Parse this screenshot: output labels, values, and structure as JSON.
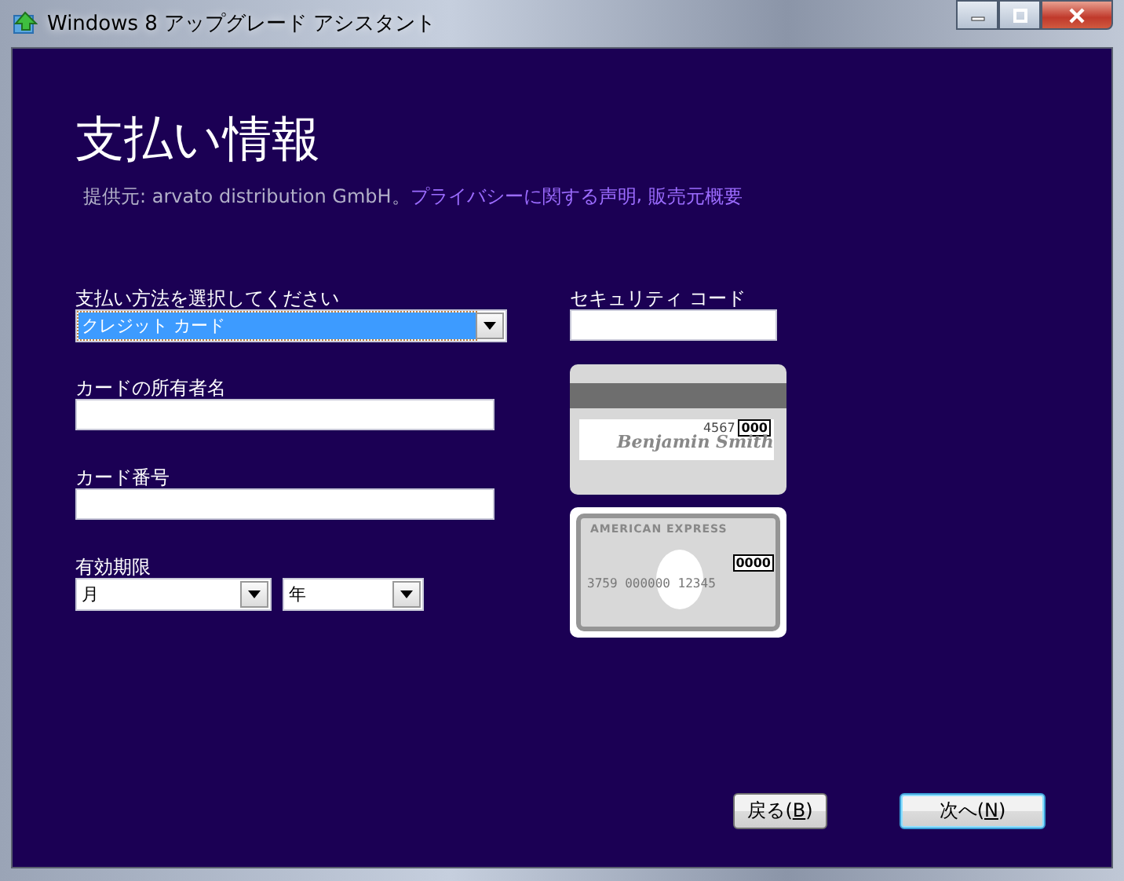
{
  "window": {
    "title": "Windows 8 アップグレード アシスタント"
  },
  "page": {
    "heading": "支払い情報",
    "provider": "提供元: arvato distribution GmbH。",
    "links": [
      "プライバシーに関する声明",
      "販売元概要"
    ],
    "link_separator": ", "
  },
  "left_fields": [
    {
      "kind": "select",
      "label": "支払い方法を選択してください",
      "value": "クレジット カード",
      "focused": true
    },
    {
      "kind": "text",
      "label": "カードの所有者名"
    },
    {
      "kind": "text",
      "label": "カード番号"
    },
    {
      "kind": "date",
      "label": "有効期限",
      "selects": [
        "月",
        "年"
      ]
    }
  ],
  "security": {
    "label": "セキュリティ コード"
  },
  "card_back": {
    "name": "Benjamin Smith",
    "digits": "4567",
    "code": "000"
  },
  "card_front": {
    "brand": "AMERICAN EXPRESS",
    "code": "0000",
    "number": "3759 000000 12345"
  },
  "buttons": [
    {
      "before": "戻る(",
      "key": "B",
      "after": ")",
      "default": false
    },
    {
      "before": "次へ(",
      "key": "N",
      "after": ")",
      "default": true
    }
  ]
}
